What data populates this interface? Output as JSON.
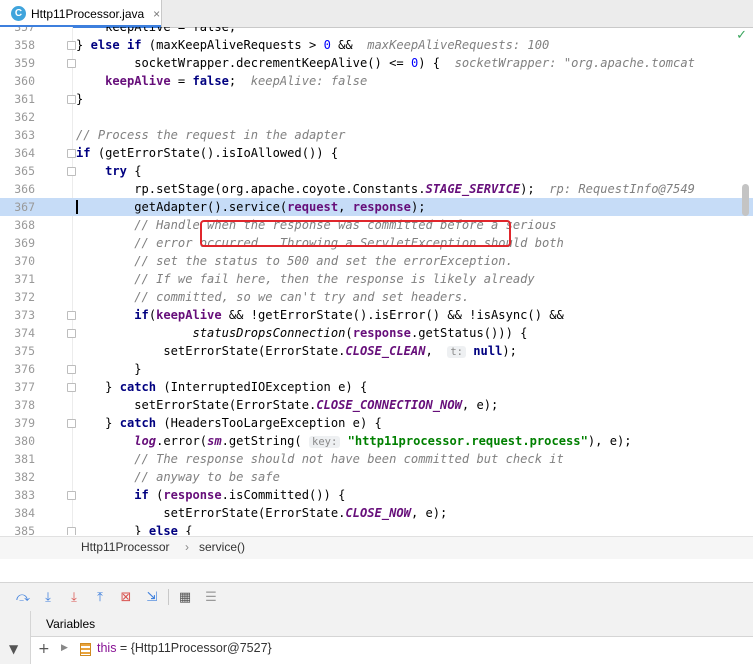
{
  "tab": {
    "icon": "C",
    "title": "Http11Processor.java",
    "close": "×"
  },
  "status": {
    "check": "✓"
  },
  "lines": [
    {
      "n": "357",
      "html": "                keepAlive = false;"
    },
    {
      "n": "358",
      "html": "            } <span class=\"k\">else if</span> (maxKeepAliveRequests &gt; <span class=\"n\">0</span> &amp;&amp;  <span class=\"h\">maxKeepAliveRequests: 100</span>"
    },
    {
      "n": "359",
      "html": "                    socketWrapper.decrementKeepAlive() &lt;= <span class=\"n\">0</span>) {  <span class=\"h\">socketWrapper: \"org.apache.tomcat</span>"
    },
    {
      "n": "360",
      "html": "                <span class=\"p\">keepAlive</span> = <span class=\"k\">false</span>;  <span class=\"h\">keepAlive: false</span>"
    },
    {
      "n": "361",
      "html": "            }"
    },
    {
      "n": "362",
      "html": ""
    },
    {
      "n": "363",
      "html": "            <span class=\"c\">// Process the request in the adapter</span>"
    },
    {
      "n": "364",
      "html": "            <span class=\"k\">if</span> (getErrorState().isIoAllowed()) {"
    },
    {
      "n": "365",
      "html": "                <span class=\"k\">try</span> {"
    },
    {
      "n": "366",
      "html": "                    rp.setStage(org.apache.coyote.Constants.<span class=\"f\">STAGE_SERVICE</span>);  <span class=\"h\">rp: RequestInfo@7549</span>"
    },
    {
      "n": "367",
      "html": "                    getAdapter().service(<span class=\"p\">request</span>, <span class=\"p\">response</span>);",
      "current": true
    },
    {
      "n": "368",
      "html": "                    <span class=\"c\">// Handle when the response was committed before a serious</span>"
    },
    {
      "n": "369",
      "html": "                    <span class=\"c\">// error occurred.  Throwing a ServletException should both</span>"
    },
    {
      "n": "370",
      "html": "                    <span class=\"c\">// set the status to 500 and set the errorException.</span>"
    },
    {
      "n": "371",
      "html": "                    <span class=\"c\">// If we fail here, then the response is likely already</span>"
    },
    {
      "n": "372",
      "html": "                    <span class=\"c\">// committed, so we can't try and set headers.</span>"
    },
    {
      "n": "373",
      "html": "                    <span class=\"k\">if</span>(<span class=\"p\">keepAlive</span> &amp;&amp; !getErrorState().isError() &amp;&amp; !isAsync() &amp;&amp;"
    },
    {
      "n": "374",
      "html": "                            <span class=\"i\">statusDropsConnection</span>(<span class=\"p\">response</span>.getStatus())) {"
    },
    {
      "n": "375",
      "html": "                        setErrorState(ErrorState.<span class=\"f\">CLOSE_CLEAN</span>,  <span class=\"pill\">t:</span> <span class=\"k\">null</span>);"
    },
    {
      "n": "376",
      "html": "                    }"
    },
    {
      "n": "377",
      "html": "                } <span class=\"k\">catch</span> (InterruptedIOException e) {"
    },
    {
      "n": "378",
      "html": "                    setErrorState(ErrorState.<span class=\"f\">CLOSE_CONNECTION_NOW</span>, e);"
    },
    {
      "n": "379",
      "html": "                } <span class=\"k\">catch</span> (HeadersTooLargeException e) {"
    },
    {
      "n": "380",
      "html": "                    <span class=\"f\">log</span>.error(<span class=\"f\">sm</span>.getString( <span class=\"pill\">key:</span> <span class=\"s\">\"http11processor.request.process\"</span>), e);"
    },
    {
      "n": "381",
      "html": "                    <span class=\"c\">// The response should not have been committed but check it</span>"
    },
    {
      "n": "382",
      "html": "                    <span class=\"c\">// anyway to be safe</span>"
    },
    {
      "n": "383",
      "html": "                    <span class=\"k\">if</span> (<span class=\"p\">response</span>.isCommitted()) {"
    },
    {
      "n": "384",
      "html": "                        setErrorState(ErrorState.<span class=\"f\">CLOSE_NOW</span>, e);"
    },
    {
      "n": "385",
      "html": "                    } <span class=\"k\">else</span> {"
    }
  ],
  "breadcrumb": {
    "class": "Http11Processor",
    "sep": "›",
    "method": "service()"
  },
  "toolbar": {
    "buttons": [
      {
        "name": "step-over-icon",
        "glyph": "⤼",
        "color": "#3d7fdd"
      },
      {
        "name": "step-into-icon",
        "glyph": "⤓",
        "color": "#3d7fdd"
      },
      {
        "name": "force-step-into-icon",
        "glyph": "⤓",
        "color": "#d9534f"
      },
      {
        "name": "step-out-icon",
        "glyph": "⤒",
        "color": "#3d7fdd"
      },
      {
        "name": "drop-frame-icon",
        "glyph": "⊠",
        "color": "#d9534f"
      },
      {
        "name": "run-to-cursor-icon",
        "glyph": "⇲",
        "color": "#3d7fdd"
      },
      {
        "name": "evaluate-expression-icon",
        "glyph": "▦",
        "color": "#555555"
      },
      {
        "name": "trace-icon",
        "glyph": "☰",
        "color": "#9a9a9a"
      }
    ]
  },
  "variables": {
    "tab_label": "Variables",
    "filter_icon": "▼",
    "add_icon": "+",
    "expand_icon": "▶",
    "row_name": "this",
    "row_value": " = {Http11Processor@7527}"
  },
  "colors": {
    "accent": "#3d7fdd",
    "highlight_box": "#e0262c",
    "current_line": "#c6dcf7"
  }
}
